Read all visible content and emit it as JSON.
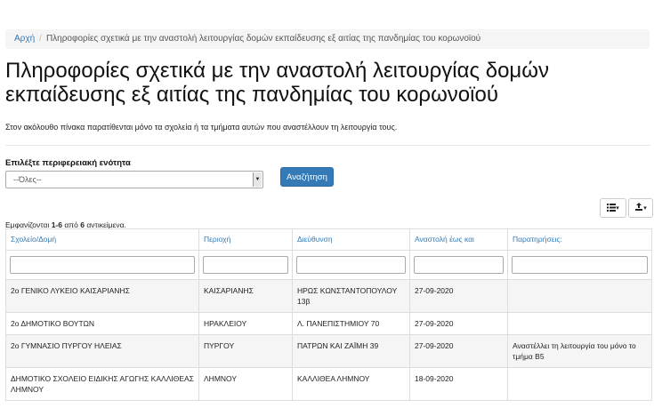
{
  "breadcrumb": {
    "home": "Αρχή",
    "separator": "/",
    "current": "Πληροφορίες σχετικά με την αναστολή λειτουργίας δομών εκπαίδευσης εξ αιτίας της πανδημίας του κορωνοϊού"
  },
  "page_title": "Πληροφορίες σχετικά με την αναστολή λειτουργίας δομών εκπαίδευσης εξ αιτίας της πανδημίας του κορωνοϊού",
  "intro_text": "Στον ακόλουθο πίνακα παρατίθενται μόνο τα σχολεία ή τα τμήματα αυτών που αναστέλλουν τη λειτουργία τους.",
  "filter": {
    "label": "Επιλέξτε περιφερειακή ενότητα",
    "selected": "--Όλες--",
    "search_button": "Αναζήτηση"
  },
  "toolbar": {
    "columns_icon": "list-icon",
    "export_icon": "export-icon",
    "caret": "▾"
  },
  "summary": {
    "prefix": "Εμφανίζονται ",
    "range": "1-6",
    "middle": " από ",
    "total": "6",
    "suffix": " αντικείμενα."
  },
  "table": {
    "headers": [
      "Σχολείο/Δομή",
      "Περιοχή",
      "Διεύθυνση",
      "Αναστολή έως και",
      "Παρατηρήσεις:"
    ],
    "rows": [
      [
        "2ο ΓΕΝΙΚΟ ΛΥΚΕΙΟ ΚΑΙΣΑΡΙΑΝΗΣ",
        "ΚΑΙΣΑΡΙΑΝΗΣ",
        "ΗΡΩΣ ΚΩΝΣΤΑΝΤΟΠΟΥΛΟΥ 13β",
        "27-09-2020",
        ""
      ],
      [
        "2ο ΔΗΜΟΤΙΚΟ ΒΟΥΤΩΝ",
        "ΗΡΑΚΛΕΙΟΥ",
        "Λ. ΠΑΝΕΠΙΣΤΗΜΙΟΥ 70",
        "27-09-2020",
        ""
      ],
      [
        "2ο ΓΥΜΝΑΣΙΟ ΠΥΡΓΟΥ ΗΛΕΙΑΣ",
        "ΠΥΡΓΟΥ",
        "ΠΑΤΡΩΝ ΚΑΙ ΖΑΪΜΗ 39",
        "27-09-2020",
        "Αναστέλλει τη λειτουργία του μόνο το τμήμα Β5"
      ],
      [
        "ΔΗΜΟΤΙΚΟ ΣΧΟΛΕΙΟ ΕΙΔΙΚΗΣ ΑΓΩΓΗΣ ΚΑΛΛΙΘΕΑΣ ΛΗΜΝΟΥ",
        "ΛΗΜΝΟΥ",
        "ΚΑΛΛΙΘΕΑ ΛΗΜΝΟΥ",
        "18-09-2020",
        ""
      ]
    ]
  },
  "colors": {
    "link": "#337ab7",
    "primary_button": "#337ab7",
    "stripe": "#f5f5f5",
    "breadcrumb_bg": "#f5f5f5"
  }
}
